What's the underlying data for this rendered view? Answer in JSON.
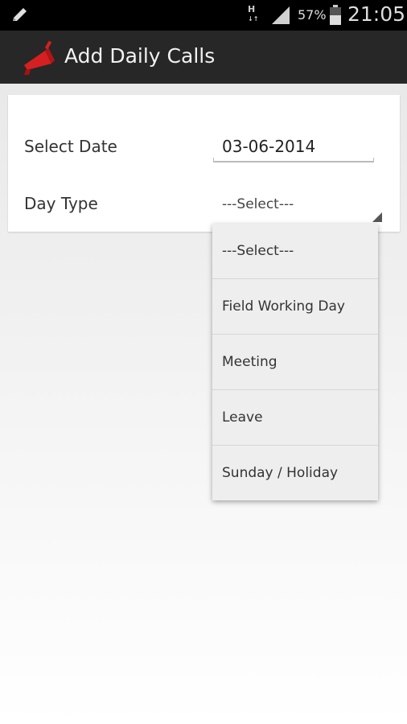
{
  "status_bar": {
    "network_type": "H",
    "battery_percent": "57%",
    "time": "21:05",
    "icons": [
      "edit-notification-icon",
      "network-h-icon",
      "signal-icon",
      "battery-icon"
    ]
  },
  "action_bar": {
    "title": "Add Daily Calls",
    "app_icon": "megaphone-icon"
  },
  "form": {
    "date_label": "Select Date",
    "date_value": "03-06-2014",
    "day_type_label": "Day Type",
    "day_type_selected": "---Select---"
  },
  "dropdown": {
    "options": [
      "---Select---",
      "Field Working Day",
      "Meeting",
      "Leave",
      "Sunday / Holiday"
    ]
  },
  "colors": {
    "status_bar_bg": "#000000",
    "action_bar_bg": "#272727",
    "app_icon_red": "#d42020",
    "dropdown_bg": "#eeeeee"
  }
}
